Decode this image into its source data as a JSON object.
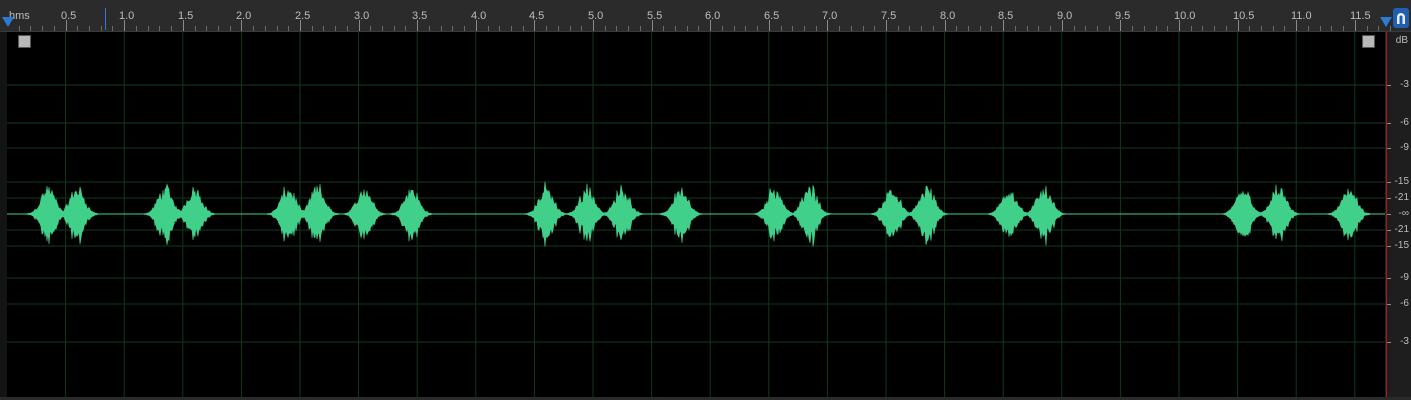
{
  "ruler": {
    "unit_label": "hms",
    "time_ticks": [
      "0.5",
      "1.0",
      "1.5",
      "2.0",
      "2.5",
      "3.0",
      "3.5",
      "4.0",
      "4.5",
      "5.0",
      "5.5",
      "6.0",
      "6.5",
      "7.0",
      "7.5",
      "8.0",
      "8.5",
      "9.0",
      "9.5",
      "10.0",
      "10.5",
      "11.0",
      "11.5"
    ]
  },
  "db_scale": {
    "unit": "dB",
    "labels": [
      "-3",
      "-6",
      "-9",
      "-15",
      "-21",
      "-∞",
      "-21",
      "-15",
      "-9",
      "-6",
      "-3"
    ]
  },
  "colors": {
    "waveform": "#41d08a",
    "grid": "#0f3a1a",
    "background": "#000000",
    "marker": "#2b7bd6",
    "db_border": "#b01c1c"
  },
  "icons": {
    "snap": "magnet-icon",
    "fade_in": "fade-in-handle-icon",
    "fade_out": "fade-out-handle-icon"
  },
  "waveform": {
    "duration_seconds": 11.8,
    "bursts_seconds": [
      0.35,
      0.6,
      1.35,
      1.6,
      2.4,
      2.65,
      3.05,
      3.45,
      4.6,
      4.95,
      5.25,
      5.75,
      6.55,
      6.85,
      7.55,
      7.85,
      8.55,
      8.85,
      10.55,
      10.85,
      11.45
    ]
  }
}
